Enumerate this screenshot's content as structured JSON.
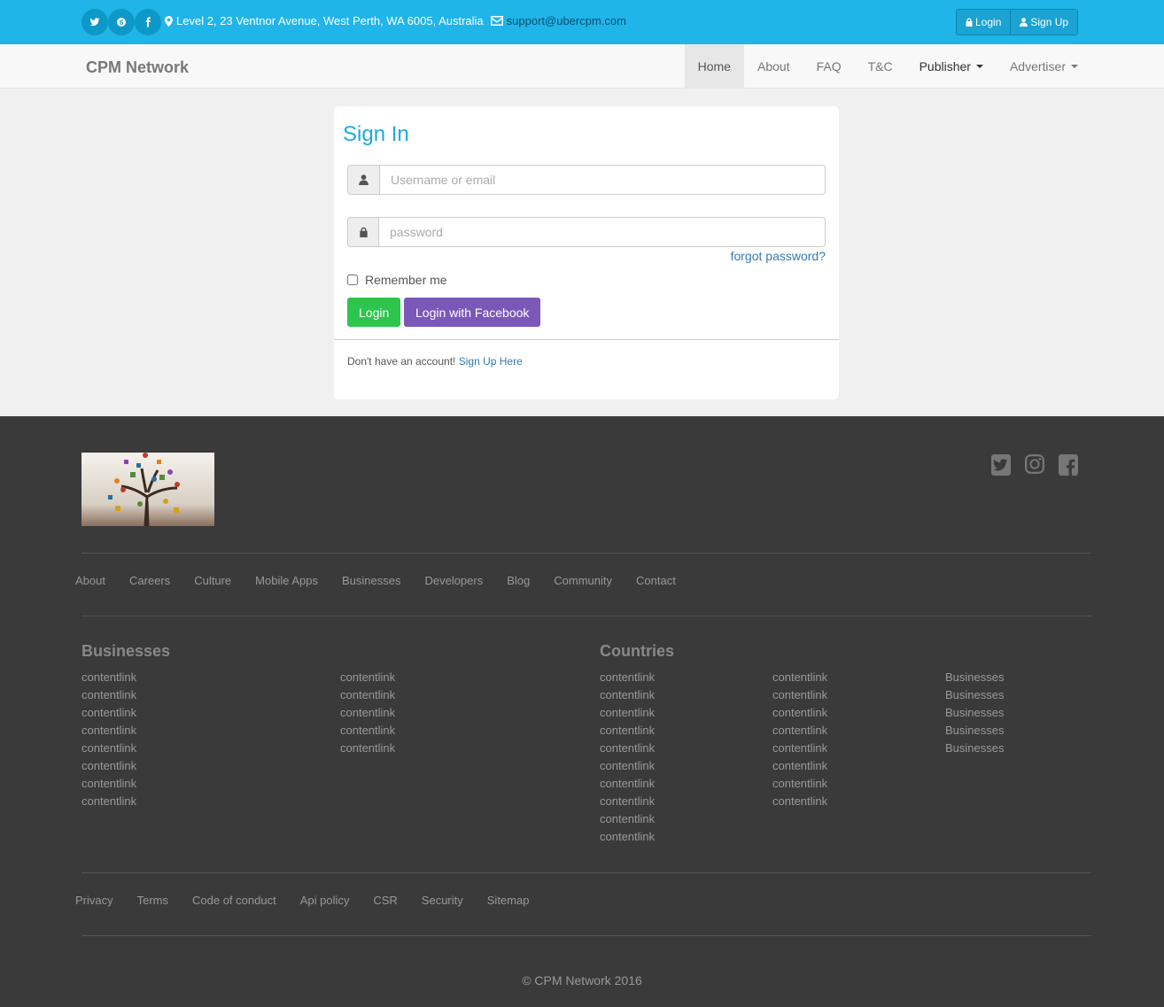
{
  "topbar": {
    "address": "Level 2, 23 Ventnor Avenue, West Perth, WA 6005, Australia",
    "email": "support@ubercpm.com",
    "login_label": "Login",
    "signup_label": "Sign Up",
    "accent_color": "#1fb5e8"
  },
  "navbar": {
    "brand": "CPM Network",
    "items": [
      {
        "label": "Home"
      },
      {
        "label": "About"
      },
      {
        "label": "FAQ"
      },
      {
        "label": "T&C"
      },
      {
        "label": "Publisher"
      },
      {
        "label": "Advertiser"
      }
    ]
  },
  "signin": {
    "title": "Sign In",
    "username_placeholder": "Username or email",
    "password_placeholder": "password",
    "forgot_label": "forgot password?",
    "remember_label": "Remember me",
    "login_button": "Login",
    "facebook_button": "Login with Facebook",
    "no_account_text": "Don't have an account!",
    "signup_link": "Sign Up Here",
    "login_color": "#2ec54e",
    "facebook_color": "#7a58b8"
  },
  "footer": {
    "nav_links": [
      "About",
      "Careers",
      "Culture",
      "Mobile Apps",
      "Businesses",
      "Developers",
      "Blog",
      "Community",
      "Contact"
    ],
    "businesses_title": "Businesses",
    "countries_title": "Countries",
    "businesses_col1": [
      "contentlink",
      "contentlink",
      "contentlink",
      "contentlink",
      "contentlink",
      "contentlink",
      "contentlink",
      "contentlink"
    ],
    "businesses_col2": [
      "contentlink",
      "contentlink",
      "contentlink",
      "contentlink",
      "contentlink"
    ],
    "countries_col1": [
      "contentlink",
      "contentlink",
      "contentlink",
      "contentlink",
      "contentlink",
      "contentlink",
      "contentlink",
      "contentlink",
      "contentlink",
      "contentlink"
    ],
    "countries_col2": [
      "contentlink",
      "contentlink",
      "contentlink",
      "contentlink",
      "contentlink",
      "contentlink",
      "contentlink",
      "contentlink"
    ],
    "countries_col3": [
      "Businesses",
      "Businesses",
      "Businesses",
      "Businesses",
      "Businesses"
    ],
    "legal_links": [
      "Privacy",
      "Terms",
      "Code of conduct",
      "Api policy",
      "CSR",
      "Security",
      "Sitemap"
    ],
    "copyright": "© CPM Network 2016",
    "social_icons": [
      "twitter-square-icon",
      "instagram-icon",
      "facebook-square-icon"
    ]
  }
}
